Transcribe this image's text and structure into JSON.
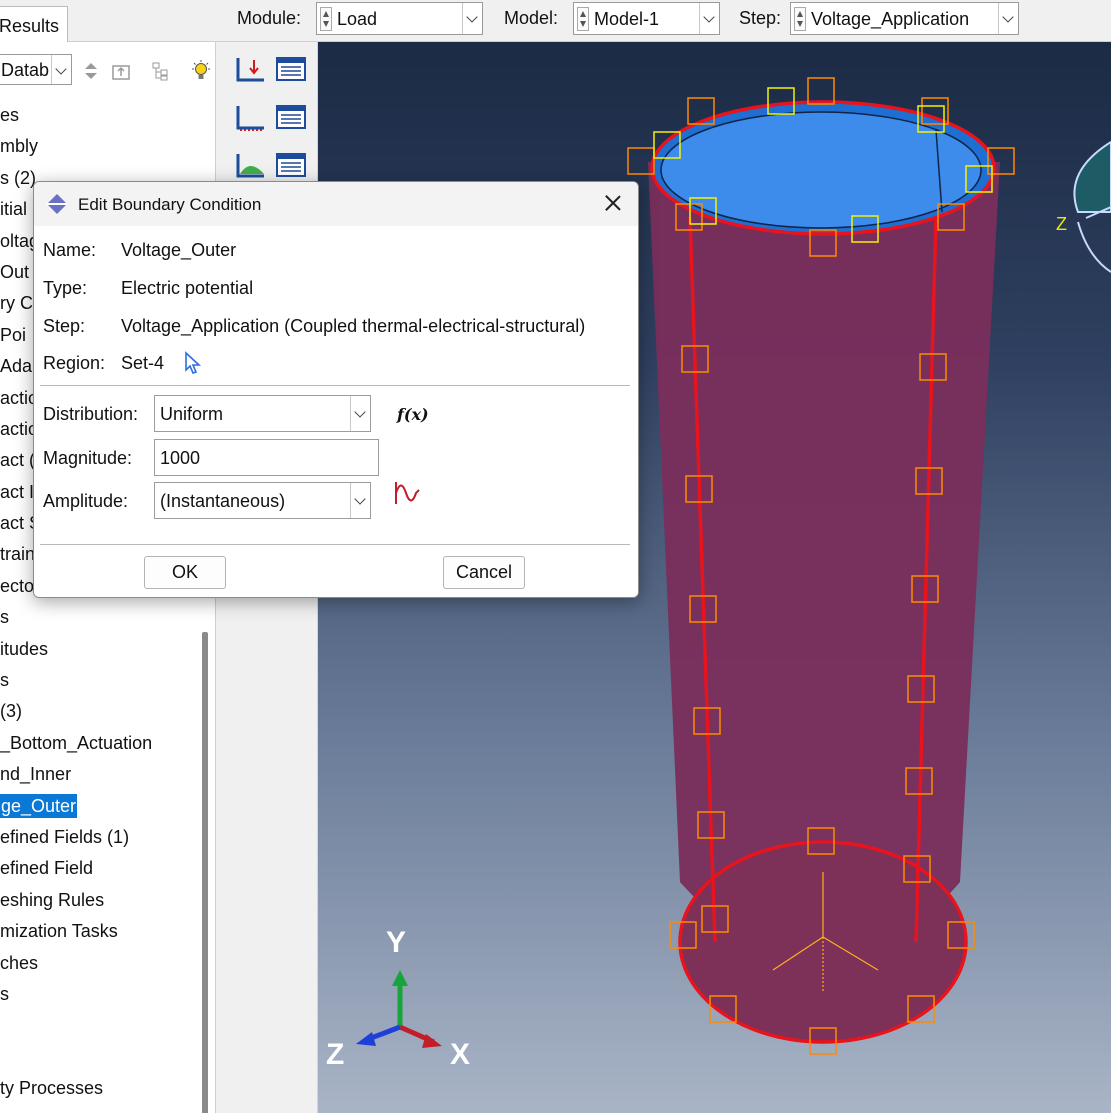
{
  "topbar": {
    "results_tab": "Results",
    "module_label": "Module:",
    "module_value": "Load",
    "model_label": "Model:",
    "model_value": "Model-1",
    "step_label": "Step:",
    "step_value": "Voltage_Application"
  },
  "tree": {
    "db_combo": "Datab",
    "items": [
      "es",
      "mbly",
      "s (2)",
      "itial",
      "oltag",
      " Out",
      "ry C",
      " Poi",
      "Adap",
      "actio",
      "actio",
      "act (",
      "act I",
      "act S",
      "train",
      "ecto",
      "s",
      "itudes",
      "s",
      "(3)",
      "_Bottom_Actuation",
      "nd_Inner",
      "ge_Outer",
      "efined Fields (1)",
      "efined Field",
      "eshing Rules",
      "mization Tasks",
      "ches",
      "s",
      "",
      "",
      "ty Processes"
    ],
    "selected_index": 22
  },
  "dialog": {
    "title": "Edit Boundary Condition",
    "name_label": "Name:",
    "name_value": "Voltage_Outer",
    "type_label": "Type:",
    "type_value": "Electric potential",
    "step_label": "Step:",
    "step_value": "Voltage_Application (Coupled thermal-electrical-structural)",
    "region_label": "Region:",
    "region_value": "Set-4",
    "distribution_label": "Distribution:",
    "distribution_value": "Uniform",
    "fx_label": "f(x)",
    "magnitude_label": "Magnitude:",
    "magnitude_value": "1000",
    "amplitude_label": "Amplitude:",
    "amplitude_value": "(Instantaneous)",
    "ok_label": "OK",
    "cancel_label": "Cancel"
  },
  "viewport": {
    "triad_y": "Y",
    "triad_z": "Z",
    "triad_x": "X",
    "view_cube_label": "Z"
  },
  "colors": {
    "accent_selection": "#0a78d7",
    "shell_color": "#7a2f5c",
    "edge_highlight": "#e8131c",
    "marker_orange": "#ff8a00",
    "marker_yellow": "#f1f108",
    "inner_surface": "#1e6fd1"
  }
}
